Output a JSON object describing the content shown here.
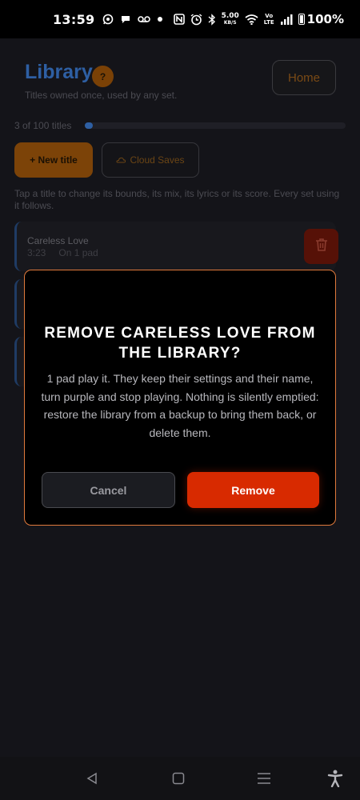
{
  "status_bar": {
    "time": "13:59",
    "left_icons": [
      "whatsapp-icon",
      "chat-icon",
      "voicemail-icon",
      "dot-icon"
    ],
    "right_icons": [
      "nfc-icon",
      "alarm-icon",
      "bluetooth-icon",
      "data-speed-icon",
      "wifi-icon",
      "volte-icon",
      "signal-icon",
      "battery-icon"
    ],
    "data_speed_value": "5.00",
    "data_speed_unit": "KB/S",
    "volte_top": "Vo",
    "volte_bottom": "LTE",
    "battery": "100%"
  },
  "header": {
    "title": "Library",
    "help_label": "?",
    "subtitle": "Titles owned once, used by any set.",
    "home_label": "Home"
  },
  "library": {
    "count_text": "3 of 100 titles",
    "progress_fraction": 0.03,
    "new_title_label": "+ New title",
    "cloud_saves_label": "Cloud Saves",
    "hint": "Tap a title to change its bounds, its mix, its lyrics or its score. Every set using it follows.",
    "items": [
      {
        "name": "Careless Love",
        "duration": "3:23",
        "usage": "On 1 pad"
      }
    ]
  },
  "dialog": {
    "title": "REMOVE CARELESS LOVE FROM THE LIBRARY?",
    "body": "1 pad play it. They keep their settings and their name, turn purple and stop playing. Nothing is silently emptied: restore the library from a backup to bring them back, or delete them.",
    "cancel_label": "Cancel",
    "remove_label": "Remove"
  },
  "nav_bar": {
    "icons": [
      "back-icon",
      "home-icon",
      "recents-icon",
      "accessibility-icon"
    ]
  },
  "colors": {
    "accent_orange": "#e07a3c",
    "remove_red": "#d82a00",
    "title_blue": "#2e5fa3"
  }
}
